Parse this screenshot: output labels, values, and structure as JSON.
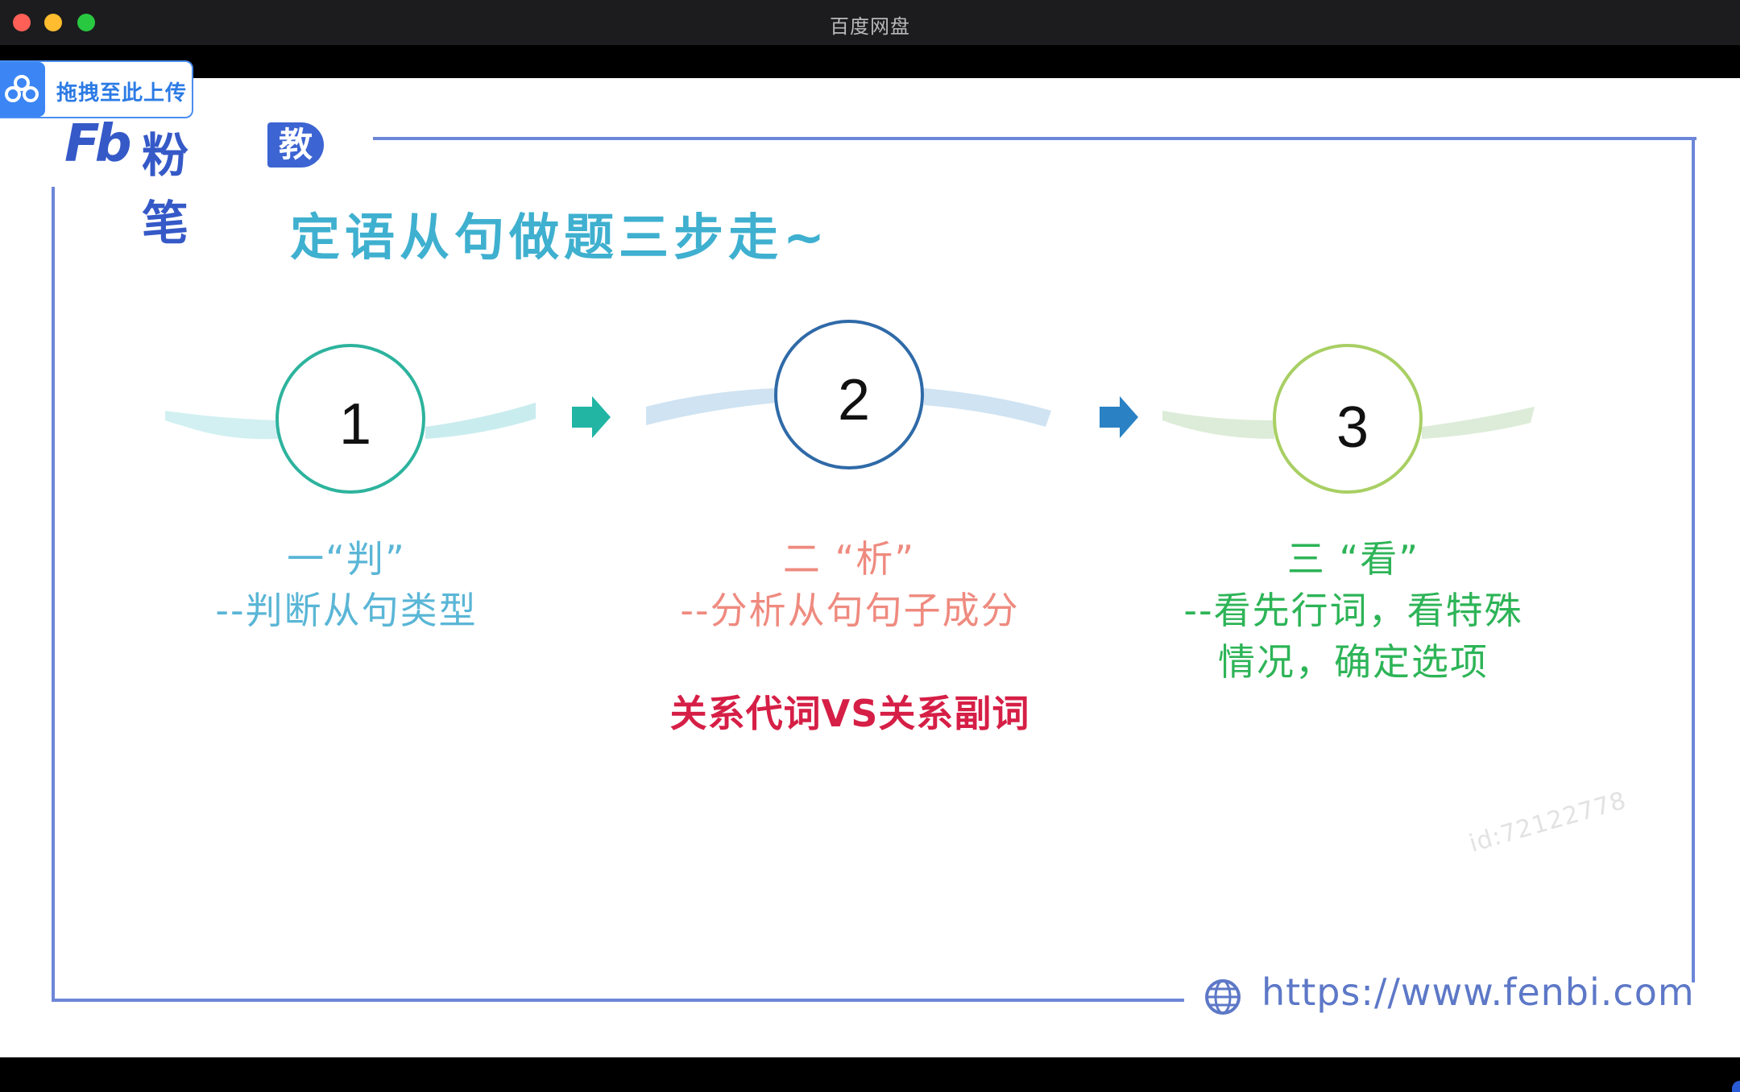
{
  "window": {
    "title": "百度网盘"
  },
  "upload_badge": {
    "label": "拖拽至此上传",
    "icon": "baidu-netdisk-icon"
  },
  "slide": {
    "logo": {
      "mark": "Fb",
      "name": "粉笔",
      "tag": "教师"
    },
    "heading": "定语从句做题三步走~",
    "steps": [
      {
        "number": "1",
        "title": "一“判”",
        "desc": [
          "--判断从句类型"
        ],
        "color": "#5ab6d6"
      },
      {
        "number": "2",
        "title": "二 “析”",
        "desc": [
          "--分析从句句子成分"
        ],
        "color": "#ef8a7f"
      },
      {
        "number": "3",
        "title": "三 “看”",
        "desc": [
          "--看先行词，看特殊",
          "情况，确定选项"
        ],
        "color": "#2db457"
      }
    ],
    "compare_note": "关系代词VS关系副词",
    "watermark": "id:72122778",
    "url": "https://www.fenbi.com",
    "url_icon": "globe-icon"
  },
  "colors": {
    "frame": "#6c86d8",
    "heading": "#3fb0cf",
    "arrow1": "#22b5a4",
    "arrow2": "#2a82c4",
    "circle1": "#2db39d",
    "circle2": "#2f6aa8",
    "circle3": "#a8cf63"
  }
}
